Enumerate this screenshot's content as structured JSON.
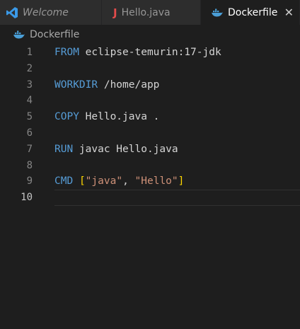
{
  "tabs": [
    {
      "label": "Welcome",
      "icon": "vscode-icon"
    },
    {
      "label": "Hello.java",
      "icon": "java-icon"
    },
    {
      "label": "Dockerfile",
      "icon": "docker-icon",
      "close": "✕"
    }
  ],
  "breadcrumb": {
    "file": "Dockerfile",
    "icon": "docker-icon"
  },
  "code": {
    "line_numbers": [
      "1",
      "2",
      "3",
      "4",
      "5",
      "6",
      "7",
      "8",
      "9",
      "10"
    ],
    "line1": {
      "kw": "FROM",
      "rest": " eclipse-temurin:17-jdk"
    },
    "line3": {
      "kw": "WORKDIR",
      "rest": " /home/app"
    },
    "line5": {
      "kw": "COPY",
      "rest": " Hello.java ."
    },
    "line7": {
      "kw": "RUN",
      "rest": " javac Hello.java"
    },
    "line9": {
      "kw": "CMD",
      "sp": " ",
      "lb": "[",
      "s1": "\"java\"",
      "comma": ", ",
      "s2": "\"Hello\"",
      "rb": "]"
    }
  },
  "colors": {
    "keyword": "#569cd6",
    "string": "#ce9178",
    "bracket": "#ffd700",
    "text": "#d4d4d4",
    "background": "#1e1e1e"
  }
}
